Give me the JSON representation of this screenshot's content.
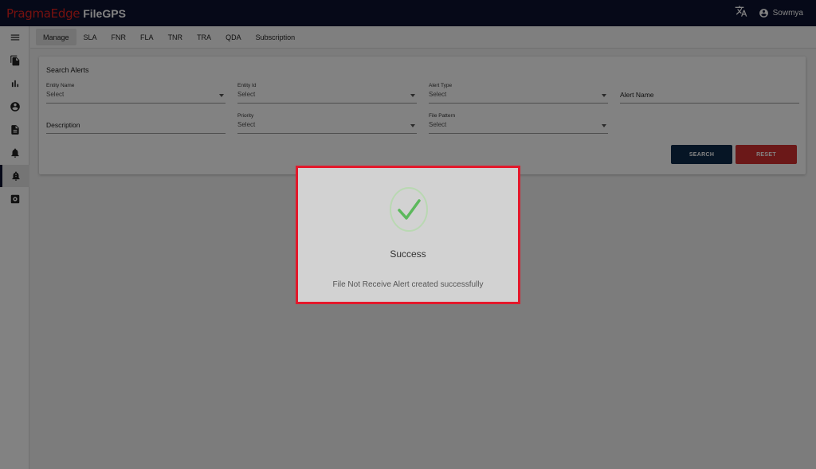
{
  "header": {
    "brand_company": "PragmaEdge",
    "brand_product": "FileGPS",
    "user_name": "Sowmya"
  },
  "sidebar": {
    "items": [
      {
        "icon": "menu-icon"
      },
      {
        "icon": "files-icon"
      },
      {
        "icon": "bar-chart-icon"
      },
      {
        "icon": "account-circle-icon"
      },
      {
        "icon": "document-icon"
      },
      {
        "icon": "bell-alert-icon"
      },
      {
        "icon": "bell-alert-active-icon",
        "active": true
      },
      {
        "icon": "settings-box-icon"
      }
    ]
  },
  "tabs": [
    "Manage",
    "SLA",
    "FNR",
    "FLA",
    "TNR",
    "TRA",
    "QDA",
    "Subscription"
  ],
  "search_alerts": {
    "title": "Search Alerts",
    "fields": {
      "entity_name": {
        "label": "Entity Name",
        "value": "Select"
      },
      "entity_id": {
        "label": "Entity Id",
        "value": "Select"
      },
      "alert_type": {
        "label": "Alert Type",
        "value": "Select"
      },
      "alert_name": {
        "placeholder": "Alert Name"
      },
      "description": {
        "placeholder": "Description"
      },
      "priority": {
        "label": "Priority",
        "value": "Select"
      },
      "file_pattern": {
        "label": "File Pattern",
        "value": "Select"
      }
    },
    "search_button": "SEARCH",
    "reset_button": "RESET"
  },
  "dialog": {
    "title": "Success",
    "message": "File Not Receive Alert created successfully"
  },
  "colors": {
    "topbar": "#0c1230",
    "brand_red": "#e8231f",
    "search_button": "#0c2a4a",
    "reset_button": "#d32f2f",
    "success_green": "#5cb85c",
    "dialog_border": "#e3182b"
  }
}
